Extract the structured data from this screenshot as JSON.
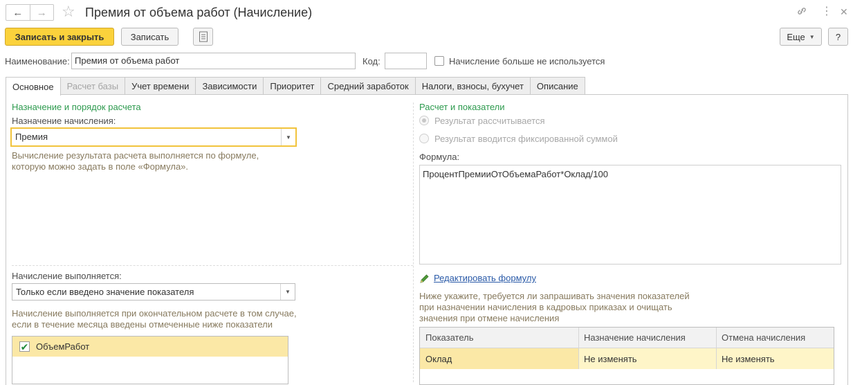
{
  "window": {
    "title": "Премия от объема работ (Начисление)",
    "icons": [
      "back-icon",
      "forward-icon",
      "star-icon",
      "link-icon",
      "more-icon",
      "close-icon"
    ]
  },
  "toolbar": {
    "save_close_label": "Записать и закрыть",
    "save_label": "Записать",
    "more_label": "Еще",
    "help_label": "?"
  },
  "header": {
    "name_label": "Наименование:",
    "name_value": "Премия от объема работ",
    "code_label": "Код:",
    "code_value": "",
    "unused_label": "Начисление больше не используется",
    "unused_checked": false
  },
  "tabs": [
    {
      "label": "Основное",
      "active": true,
      "disabled": false
    },
    {
      "label": "Расчет базы",
      "active": false,
      "disabled": true
    },
    {
      "label": "Учет времени",
      "active": false,
      "disabled": false
    },
    {
      "label": "Зависимости",
      "active": false,
      "disabled": false
    },
    {
      "label": "Приоритет",
      "active": false,
      "disabled": false
    },
    {
      "label": "Средний заработок",
      "active": false,
      "disabled": false
    },
    {
      "label": "Налоги, взносы, бухучет",
      "active": false,
      "disabled": false
    },
    {
      "label": "Описание",
      "active": false,
      "disabled": false
    }
  ],
  "left": {
    "section_title": "Назначение и порядок расчета",
    "purpose_label": "Назначение начисления:",
    "purpose_value": "Премия",
    "purpose_hint_1": "Вычисление результата расчета выполняется по формуле,",
    "purpose_hint_2": "которую можно задать в поле «Формула».",
    "execution_label": "Начисление выполняется:",
    "execution_value": "Только если введено значение показателя",
    "execution_hint_1": "Начисление выполняется при окончательном расчете в том случае,",
    "execution_hint_2": "если в течение месяца введены отмеченные ниже показатели",
    "indicators": [
      {
        "label": "ОбъемРабот",
        "checked": true
      }
    ]
  },
  "right": {
    "section_title": "Расчет и показатели",
    "radio_calculated": "Результат рассчитывается",
    "radio_fixed": "Результат вводится фиксированной суммой",
    "formula_label": "Формула:",
    "formula_value": "ПроцентПремииОтОбъемаРабот*Оклад/100",
    "edit_formula_link": "Редактировать формулу",
    "hint_1": "Ниже укажите, требуется ли запрашивать значения показателей",
    "hint_2": "при назначении начисления в кадровых приказах и очищать",
    "hint_3": "значения при отмене начисления",
    "table": {
      "headers": [
        "Показатель",
        "Назначение начисления",
        "Отмена начисления"
      ],
      "rows": [
        [
          "Оклад",
          "Не изменять",
          "Не изменять"
        ]
      ]
    }
  },
  "colors": {
    "primary_button": "#fbd23c",
    "section_title": "#2d9a4e",
    "hint_text": "#877a5e",
    "link": "#2a5aa8",
    "selected_row": "#fbe8a6"
  }
}
